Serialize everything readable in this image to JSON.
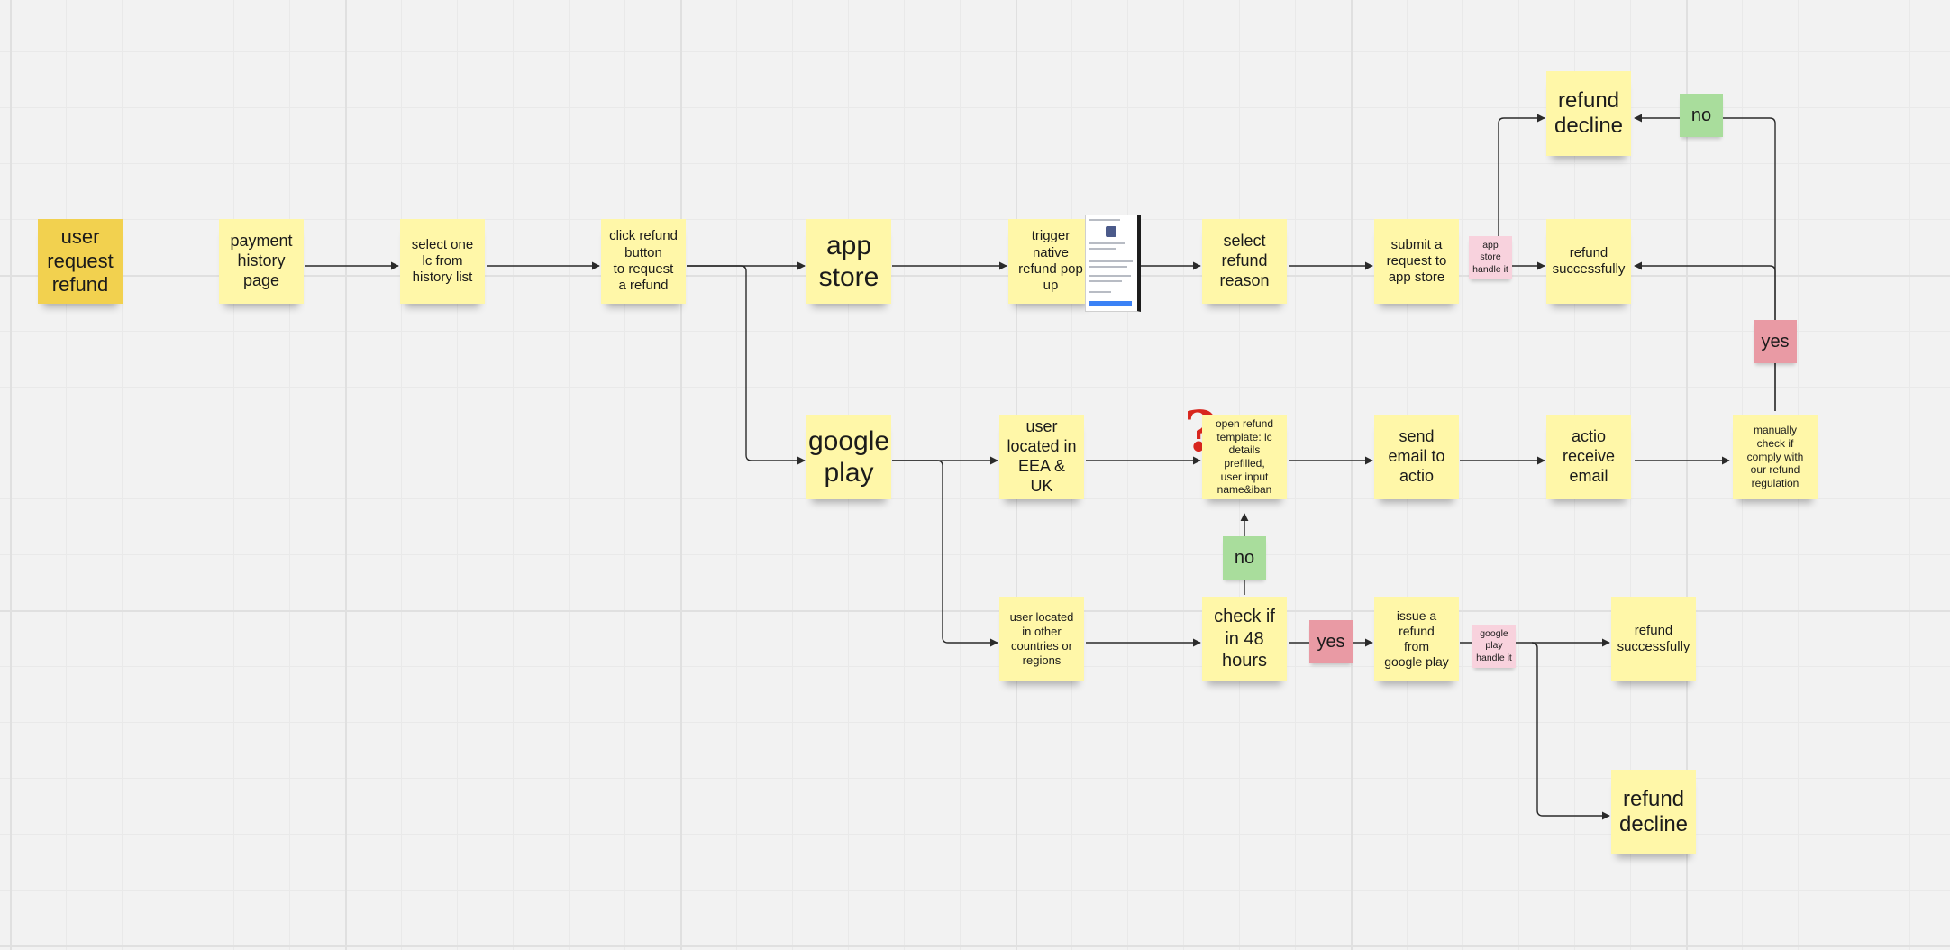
{
  "colors": {
    "yellow": "#fff7a8",
    "gold": "#f2d14f",
    "green": "#a9dd9c",
    "red": "#e99aa4",
    "pink": "#f8d2dd",
    "edge": "#2a2a2a"
  },
  "icons": {
    "question": "question-mark-icon",
    "thumbnail": "refund-popup-screenshot-thumbnail"
  },
  "notes": {
    "user_request": "user\nrequest\nrefund",
    "payment_history": "payment\nhistory\npage",
    "select_lc": "select one\nlc from\nhistory list",
    "click_refund": "click refund\nbutton\nto request\na refund",
    "app_store": "app\nstore",
    "google_play": "google\nplay",
    "trigger_popup": "trigger\nnative\nrefund pop\nup",
    "select_reason": "select\nrefund\nreason",
    "submit_request": "submit a\nrequest to\napp store",
    "app_store_handle": "app\nstore\nhandle it",
    "refund_decline_top": "refund\ndecline",
    "refund_success_top": "refund\nsuccessfully",
    "no_top": "no",
    "yes_right": "yes",
    "user_eea": "user\nlocated in\nEEA & UK",
    "open_template": "open refund\ntemplate: lc\ndetails prefilled,\nuser input\nname&iban",
    "send_email": "send\nemail to\nactio",
    "actio_receive": "actio\nreceive\nemail",
    "manual_check": "manually\ncheck if\ncomply with\nour refund\nregulation",
    "user_other": "user located\nin other\ncountries or\nregions",
    "check_48": "check if\nin 48\nhours",
    "no_mid": "no",
    "yes_mid": "yes",
    "issue_refund": "issue a\nrefund\nfrom\ngoogle play",
    "google_handle": "google\nplay\nhandle it",
    "refund_success_bottom": "refund\nsuccessfully",
    "refund_decline_bottom": "refund\ndecline"
  }
}
